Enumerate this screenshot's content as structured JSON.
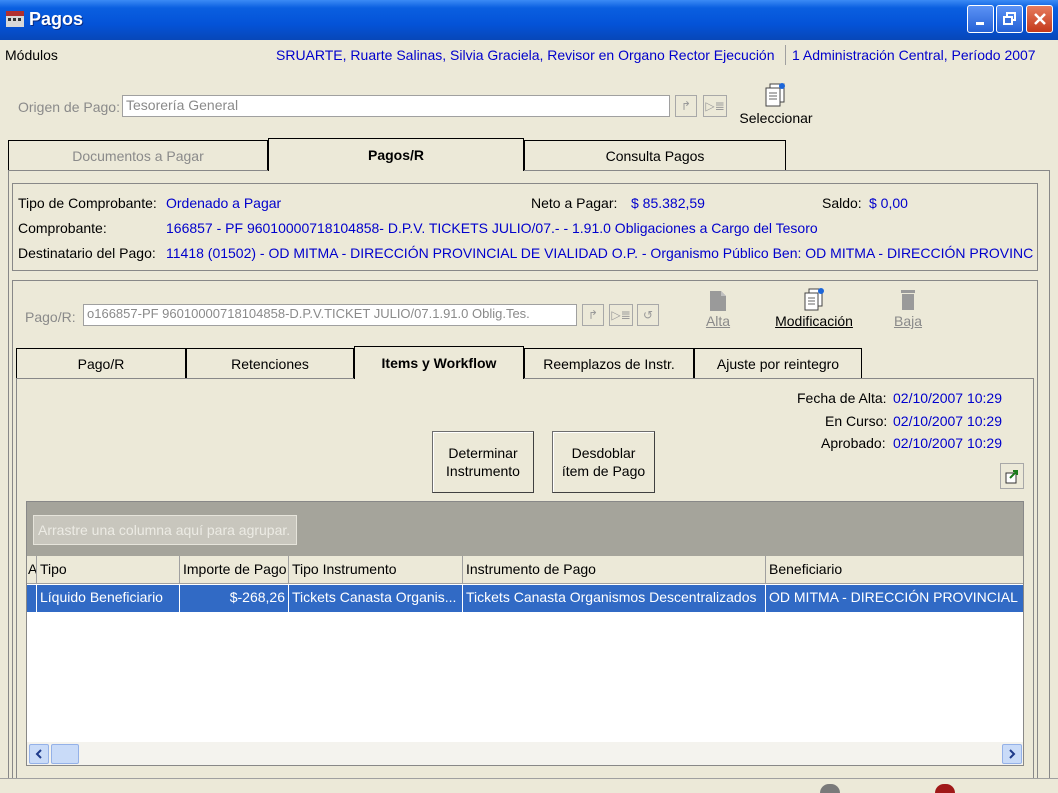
{
  "window": {
    "title": "Pagos"
  },
  "infobar": {
    "modulos": "Módulos",
    "user": "SRUARTE, Ruarte Salinas, Silvia Graciela, Revisor en Organo Rector Ejecución",
    "period": "1 Administración Central, Período 2007"
  },
  "origen": {
    "label": "Origen de Pago:",
    "value": "Tesorería General",
    "select_label": "Seleccionar"
  },
  "main_tabs": [
    "Documentos a Pagar",
    "Pagos/R",
    "Consulta Pagos"
  ],
  "summary": {
    "tipo_label": "Tipo de Comprobante:",
    "tipo_value": "Ordenado  a  Pagar",
    "neto_label": "Neto a Pagar:",
    "neto_value": "$ 85.382,59",
    "saldo_label": "Saldo:",
    "saldo_value": "$ 0,00",
    "comprobante_label": "Comprobante:",
    "comprobante_value": "166857 - PF 96010000718104858- D.P.V. TICKETS JULIO/07.- - 1.91.0 Obligaciones a Cargo del Tesoro",
    "destinatario_label": "Destinatario del Pago:",
    "destinatario_value": "11418 (01502) - OD MITMA - DIRECCIÓN PROVINCIAL DE VIALIDAD  O.P. - Organismo Público  Ben: OD MITMA - DIRECCIÓN PROVINC"
  },
  "pago": {
    "label": "Pago/R:",
    "value": "o166857-PF 96010000718104858-D.P.V.TICKET JULIO/07.1.91.0 Oblig.Tes.",
    "alta": "Alta",
    "modificacion": "Modificación",
    "baja": "Baja"
  },
  "sub_tabs": [
    "Pago/R",
    "Retenciones",
    "Items y Workflow",
    "Reemplazos de Instr.",
    "Ajuste por reintegro"
  ],
  "dates": {
    "alta_label": "Fecha de Alta:",
    "alta_value": "02/10/2007 10:29",
    "curso_label": "En Curso:",
    "curso_value": "02/10/2007 10:29",
    "aprobado_label": "Aprobado:",
    "aprobado_value": "02/10/2007 10:29"
  },
  "buttons": {
    "determinar": "Determinar Instrumento",
    "desdoblar": "Desdoblar ítem de Pago"
  },
  "grid": {
    "group_hint": "Arrastre una columna aquí para agrupar.",
    "columns": [
      "A",
      "Tipo",
      "Importe de Pago",
      "Tipo Instrumento",
      "Instrumento de Pago",
      "Beneficiario"
    ],
    "rows": [
      [
        "",
        "Líquido Beneficiario",
        "$-268,26",
        "Tickets Canasta Organis...",
        "Tickets Canasta Organismos Descentralizados",
        "OD MITMA - DIRECCIÓN PROVINCIAL"
      ]
    ]
  },
  "colors": {
    "selection": "#316ac5",
    "value_text": "#0000cc",
    "titlebar": "#0453d8"
  }
}
